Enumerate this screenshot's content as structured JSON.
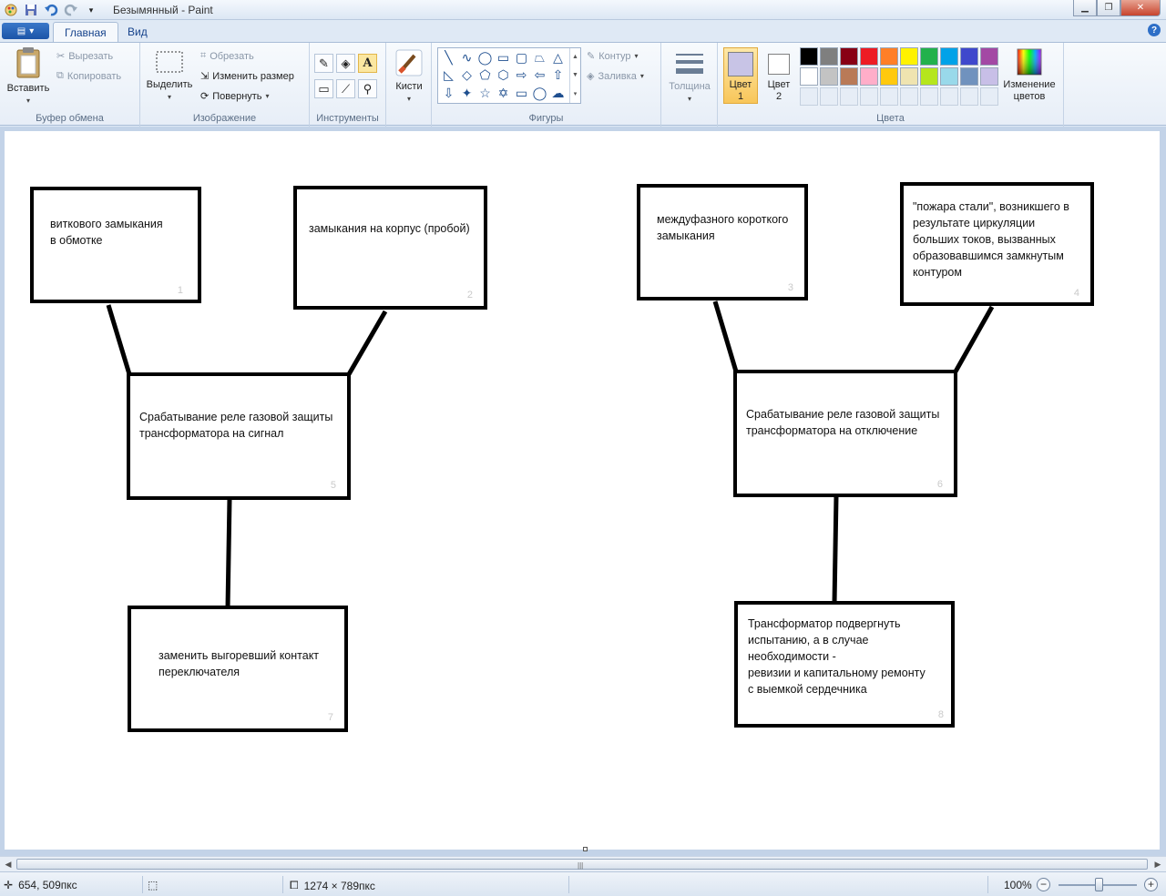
{
  "window": {
    "title": "Безымянный - Paint"
  },
  "tabs": {
    "home": "Главная",
    "view": "Вид"
  },
  "ribbon": {
    "clipboard": {
      "paste": "Вставить",
      "cut": "Вырезать",
      "copy": "Копировать",
      "label": "Буфер обмена"
    },
    "image": {
      "select": "Выделить",
      "crop": "Обрезать",
      "resize": "Изменить размер",
      "rotate": "Повернуть",
      "label": "Изображение"
    },
    "tools": {
      "label": "Инструменты"
    },
    "brushes": {
      "label": "Кисти"
    },
    "shapes": {
      "outline": "Контур",
      "fill": "Заливка",
      "label": "Фигуры"
    },
    "size": {
      "label": "Толщина"
    },
    "colors": {
      "color1_line1": "Цвет",
      "color1_line2": "1",
      "color2_line1": "Цвет",
      "color2_line2": "2",
      "edit_line1": "Изменение",
      "edit_line2": "цветов",
      "label": "Цвета",
      "color1_value": "#c8c4e6",
      "color2_value": "#ffffff",
      "palette": [
        "#000000",
        "#7f7f7f",
        "#880015",
        "#ed1c24",
        "#ff7f27",
        "#fff200",
        "#22b14c",
        "#00a2e8",
        "#3f48cc",
        "#a349a4",
        "#ffffff",
        "#c3c3c3",
        "#b97a57",
        "#ffaec9",
        "#ffc90e",
        "#efe4b0",
        "#b5e61d",
        "#99d9ea",
        "#7092be",
        "#c8bfe7"
      ]
    }
  },
  "diagram": {
    "boxes": [
      {
        "text": "виткового замыкания\n в обмотке",
        "num": "1"
      },
      {
        "text": "замыкания на корпус (пробой)",
        "num": "2"
      },
      {
        "text": "междуфазного короткого\nзамыкания",
        "num": "3"
      },
      {
        "text": "\"пожара стали\", возникшего в\nрезультате циркуляции\nбольших токов, вызванных\nобразовавшимся замкнутым\nконтуром",
        "num": "4"
      },
      {
        "text": "Срабатывание реле газовой защиты\nтрансформатора на сигнал",
        "num": "5"
      },
      {
        "text": "Срабатывание реле газовой защиты\nтрансформатора на отключение",
        "num": "6"
      },
      {
        "text": "заменить выгоревший контакт\nпереключателя",
        "num": "7"
      },
      {
        "text": "Трансформатор подвергнуть\nиспытанию, а в случае\nнеобходимости -\nревизии и капитальному ремонту\n с выемкой сердечника",
        "num": "8"
      }
    ]
  },
  "status": {
    "cursor": "654, 509пкс",
    "canvas_size": "1274 × 789пкс",
    "zoom": "100%"
  }
}
